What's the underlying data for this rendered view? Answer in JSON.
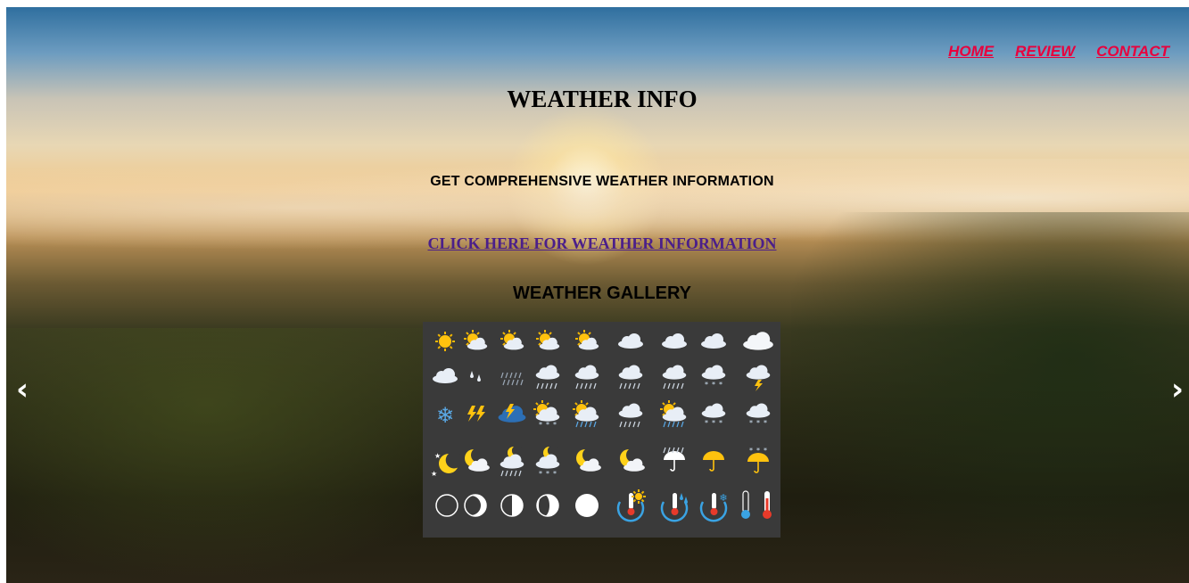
{
  "nav": {
    "home": "HOME",
    "review": "REVIEW",
    "contact": "CONTACT"
  },
  "hero": {
    "title": "WEATHER INFO",
    "subtitle": "GET COMPREHENSIVE WEATHER INFORMATION",
    "cta": "CLICK HERE FOR WEATHER INFORMATION",
    "gallery_title": "WEATHER GALLERY"
  },
  "carousel": {
    "prev": "‹",
    "next": "›"
  },
  "gallery": {
    "icons": [
      [
        "sun-icon",
        "partly-sunny-icon",
        "partly-sunny-icon",
        "partly-sunny-icon",
        "partly-sunny-icon",
        "cloud-icon",
        "cloud-icon",
        "cloud-icon",
        "fog-cloud-icon"
      ],
      [
        "cloud-icon",
        "raindrops-icon",
        "drizzle-icon",
        "rain-cloud-icon",
        "rain-cloud-icon",
        "rain-cloud-icon",
        "rain-cloud-icon",
        "snow-cloud-icon",
        "thunder-cloud-icon"
      ],
      [
        "snowflake-icon",
        "lightning-icon",
        "storm-icon",
        "sun-snow-cloud-icon",
        "sun-rain-cloud-icon",
        "rain-cloud-icon",
        "sun-rain-cloud-icon",
        "snow-cloud-icon",
        "snow-cloud-icon"
      ],
      [
        "moon-stars-icon",
        "moon-cloud-icon",
        "moon-rain-icon",
        "moon-snow-icon",
        "moon-cloud-icon",
        "moon-cloud-icon",
        "umbrella-icon",
        "umbrella-icon",
        "umbrella-snow-icon"
      ],
      [
        "new-moon-icon",
        "crescent-moon-icon",
        "half-moon-icon",
        "gibbous-moon-icon",
        "full-moon-icon",
        "thermometer-sun-icon",
        "thermometer-rain-icon",
        "thermometer-snow-icon",
        "thermometer-cold-icon"
      ]
    ]
  }
}
